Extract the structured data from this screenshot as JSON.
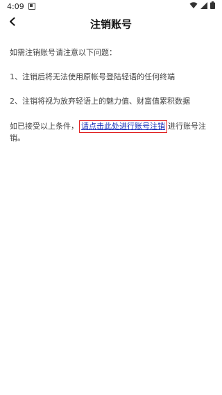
{
  "status": {
    "time": "4:09"
  },
  "header": {
    "title": "注销账号"
  },
  "content": {
    "intro": "如需注销账号请注意以下问题：",
    "item1": "1、注销后将无法使用原帐号登陆轻语的任何终端",
    "item2": "2、注销将视为放弃轻语上的魅力值、财富值累积数据",
    "final_prefix": "如已接受以上条件，",
    "final_link": "请点击此处进行账号注销",
    "final_suffix": "进行账号注销。"
  },
  "colors": {
    "link": "#1a2fb8",
    "highlight_box": "#e02020"
  },
  "icons": {
    "back": "back-arrow-icon",
    "notification": "notification-icon",
    "wifi": "wifi-icon",
    "signal": "signal-icon",
    "battery": "battery-icon"
  }
}
